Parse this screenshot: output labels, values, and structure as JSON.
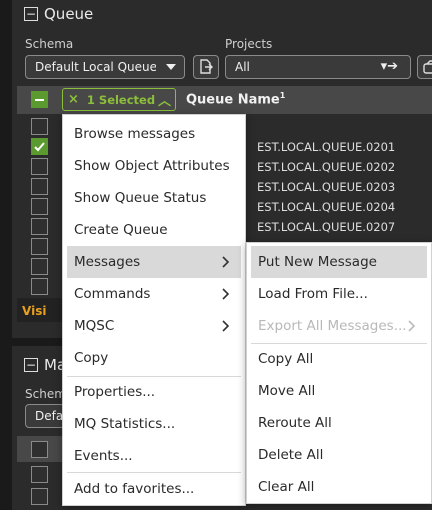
{
  "panel1": {
    "title": "Queue",
    "schema_label": "Schema",
    "schema_value": "Default Local Queues",
    "projects_label": "Projects",
    "projects_value": "All",
    "selected_chip": "1 Selected",
    "column_header": "Queue Name",
    "column_sup": "1",
    "rows": [
      "",
      "EST.LOCAL.QUEUE.0201",
      "EST.LOCAL.QUEUE.0202",
      "EST.LOCAL.QUEUE.0203",
      "EST.LOCAL.QUEUE.0204",
      "EST.LOCAL.QUEUE.0207",
      "",
      "",
      ""
    ],
    "visible_label": "Visi"
  },
  "panel2": {
    "title": "Ma",
    "schema_label": "Schem",
    "schema_value": "Defa"
  },
  "main_menu": {
    "items": [
      "Browse messages",
      "Show Object Attributes",
      "Show Queue Status",
      "Create Queue",
      "Messages",
      "Commands",
      "MQSC",
      "Copy",
      "Properties...",
      "MQ Statistics...",
      "Events...",
      "Add to favorites..."
    ]
  },
  "sub_menu": {
    "items": [
      "Put New Message",
      "Load From File...",
      "Export All Messages...",
      "Copy All",
      "Move All",
      "Reroute All",
      "Delete All",
      "Clear All"
    ]
  },
  "colors": {
    "accent_green": "#8bbf3a",
    "check_green": "#5b9a2f",
    "warning_orange": "#e8a020",
    "panel_bg": "#2b2b2b"
  }
}
